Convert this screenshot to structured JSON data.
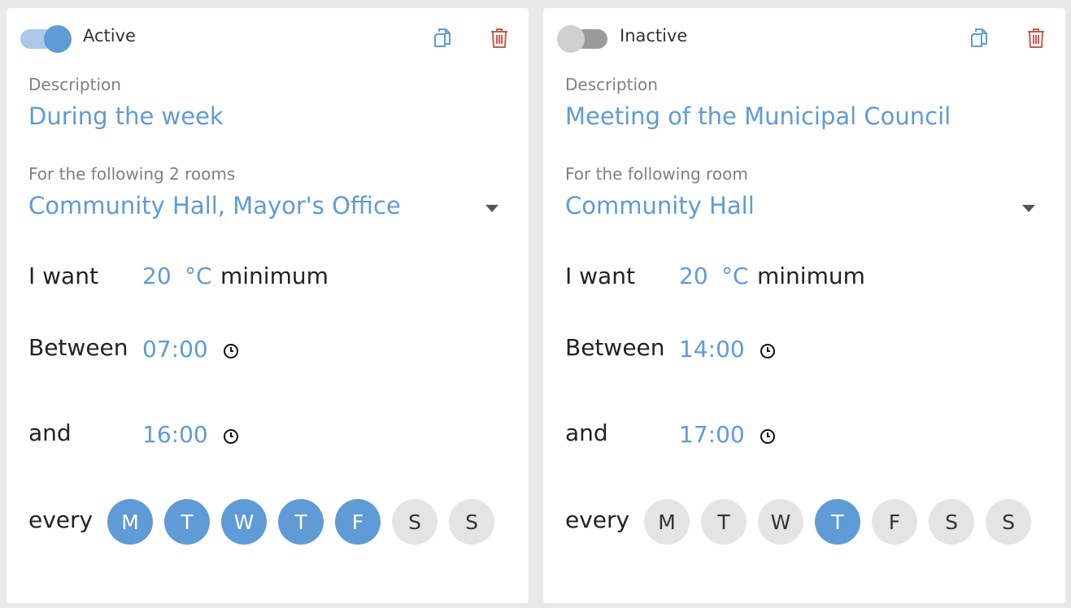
{
  "colors": {
    "accent": "#5f9bd6",
    "trash": "#c85a50",
    "inactive_day": "#e4e4e4"
  },
  "cards": [
    {
      "active": true,
      "status_label": "Active",
      "description_label": "Description",
      "description": "During the week",
      "rooms_label": "For the following 2 rooms",
      "rooms": "Community Hall, Mayor's Office",
      "want_label": "I want",
      "temperature": "20",
      "unit": "°C",
      "minimum_label": "minimum",
      "between_label": "Between",
      "start_time": "07:00",
      "and_label": "and",
      "end_time": "16:00",
      "every_label": "every",
      "days": [
        {
          "label": "M",
          "selected": true
        },
        {
          "label": "T",
          "selected": true
        },
        {
          "label": "W",
          "selected": true
        },
        {
          "label": "T",
          "selected": true
        },
        {
          "label": "F",
          "selected": true
        },
        {
          "label": "S",
          "selected": false
        },
        {
          "label": "S",
          "selected": false
        }
      ],
      "icons": {
        "copy": "copy-icon",
        "delete": "trash-icon",
        "clock": "clock-icon",
        "dropdown": "caret-down-icon"
      }
    },
    {
      "active": false,
      "status_label": "Inactive",
      "description_label": "Description",
      "description": "Meeting of the Municipal Council",
      "rooms_label": "For the following room",
      "rooms": "Community Hall",
      "want_label": "I want",
      "temperature": "20",
      "unit": "°C",
      "minimum_label": "minimum",
      "between_label": "Between",
      "start_time": "14:00",
      "and_label": "and",
      "end_time": "17:00",
      "every_label": "every",
      "days": [
        {
          "label": "M",
          "selected": false
        },
        {
          "label": "T",
          "selected": false
        },
        {
          "label": "W",
          "selected": false
        },
        {
          "label": "T",
          "selected": true
        },
        {
          "label": "F",
          "selected": false
        },
        {
          "label": "S",
          "selected": false
        },
        {
          "label": "S",
          "selected": false
        }
      ],
      "icons": {
        "copy": "copy-icon",
        "delete": "trash-icon",
        "clock": "clock-icon",
        "dropdown": "caret-down-icon"
      }
    }
  ]
}
